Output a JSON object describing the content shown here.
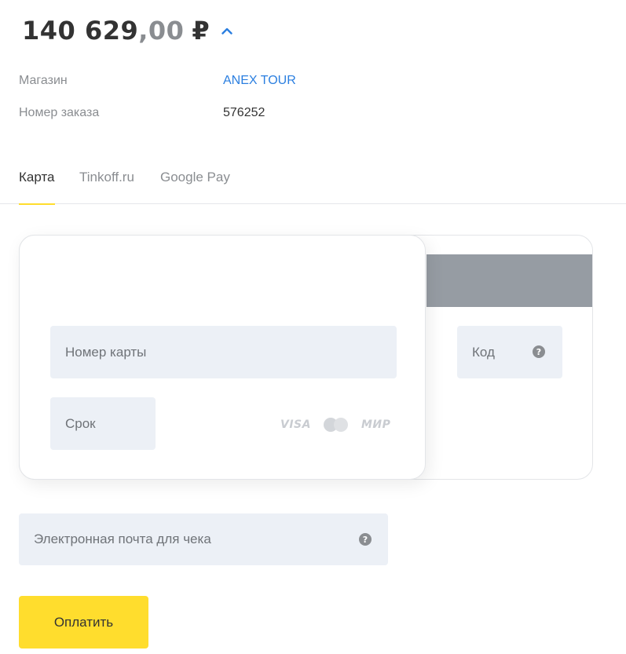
{
  "amount": {
    "integer": "140 629",
    "decimal": ",00",
    "currency": "₽",
    "toggle_icon": "chevron-up-icon"
  },
  "info": {
    "shop_label": "Магазин",
    "shop_value": "ANEX TOUR",
    "order_label": "Номер заказа",
    "order_value": "576252"
  },
  "tabs": [
    {
      "label": "Карта",
      "active": true
    },
    {
      "label": "Tinkoff.ru",
      "active": false
    },
    {
      "label": "Google Pay",
      "active": false
    }
  ],
  "card": {
    "number_placeholder": "Номер карты",
    "expiry_placeholder": "Срок",
    "cvc_placeholder": "Код",
    "logos": {
      "visa": "VISA",
      "mir": "МИР",
      "mastercard_icon": "mastercard-icon"
    },
    "help_icon": "?"
  },
  "email": {
    "placeholder": "Электронная почта для чека",
    "help_icon": "?"
  },
  "pay_button": {
    "label": "Оплатить"
  },
  "colors": {
    "accent_yellow": "#ffdd2d",
    "link_blue": "#2b7fe0",
    "field_bg": "#ecf0f6",
    "stripe_gray": "#969ca3"
  }
}
